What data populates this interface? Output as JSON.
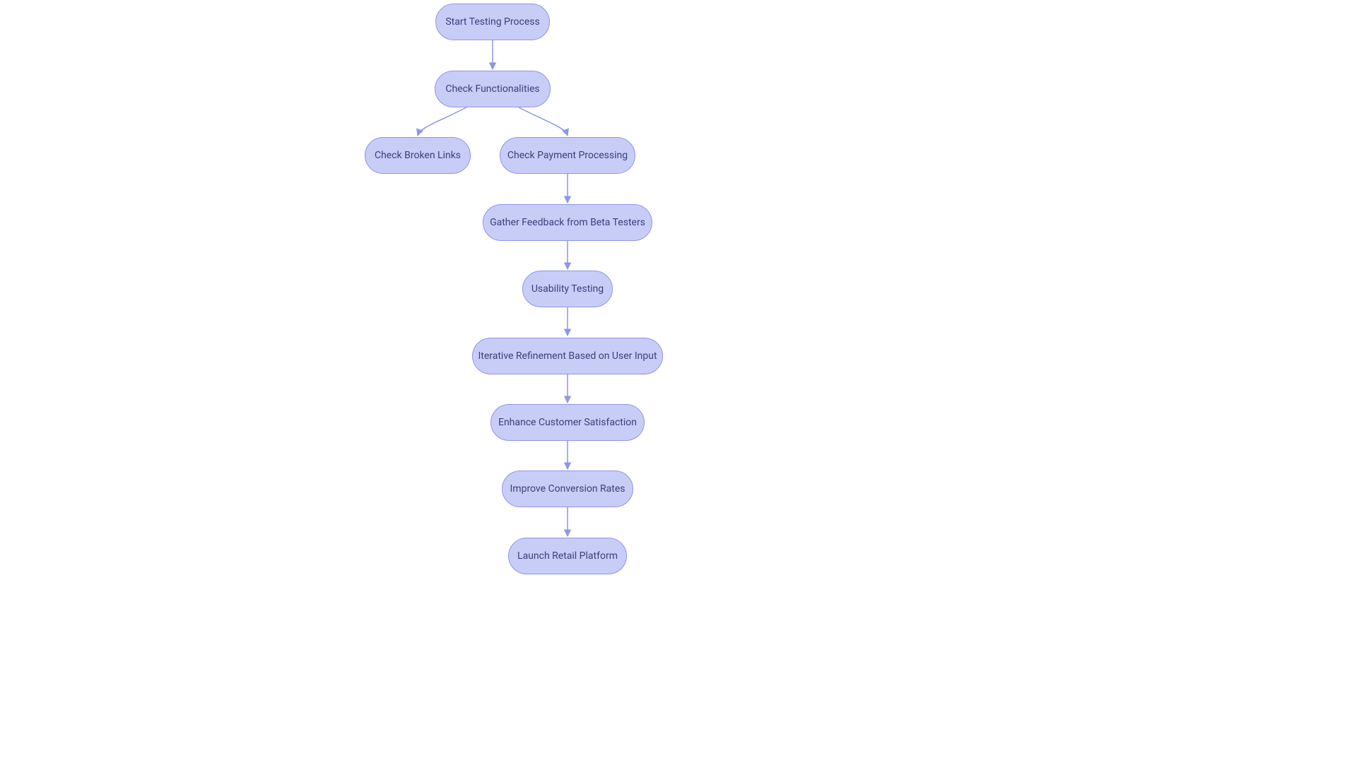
{
  "colors": {
    "node_fill": "#c7cdf7",
    "node_border": "#8e96e6",
    "node_text": "#3a3f7a",
    "edge": "#8e96e6"
  },
  "nodes": {
    "n1": {
      "label": "Start Testing Process"
    },
    "n2": {
      "label": "Check Functionalities"
    },
    "n3": {
      "label": "Check Broken Links"
    },
    "n4": {
      "label": "Check Payment Processing"
    },
    "n5": {
      "label": "Gather Feedback from Beta Testers"
    },
    "n6": {
      "label": "Usability Testing"
    },
    "n7": {
      "label": "Iterative Refinement Based on User Input"
    },
    "n8": {
      "label": "Enhance Customer Satisfaction"
    },
    "n9": {
      "label": "Improve Conversion Rates"
    },
    "n10": {
      "label": "Launch Retail Platform"
    }
  },
  "chart_data": {
    "type": "flowchart",
    "nodes": [
      {
        "id": "n1",
        "label": "Start Testing Process"
      },
      {
        "id": "n2",
        "label": "Check Functionalities"
      },
      {
        "id": "n3",
        "label": "Check Broken Links"
      },
      {
        "id": "n4",
        "label": "Check Payment Processing"
      },
      {
        "id": "n5",
        "label": "Gather Feedback from Beta Testers"
      },
      {
        "id": "n6",
        "label": "Usability Testing"
      },
      {
        "id": "n7",
        "label": "Iterative Refinement Based on User Input"
      },
      {
        "id": "n8",
        "label": "Enhance Customer Satisfaction"
      },
      {
        "id": "n9",
        "label": "Improve Conversion Rates"
      },
      {
        "id": "n10",
        "label": "Launch Retail Platform"
      }
    ],
    "edges": [
      {
        "from": "n1",
        "to": "n2"
      },
      {
        "from": "n2",
        "to": "n3"
      },
      {
        "from": "n2",
        "to": "n4"
      },
      {
        "from": "n4",
        "to": "n5"
      },
      {
        "from": "n5",
        "to": "n6"
      },
      {
        "from": "n6",
        "to": "n7"
      },
      {
        "from": "n7",
        "to": "n8"
      },
      {
        "from": "n8",
        "to": "n9"
      },
      {
        "from": "n9",
        "to": "n10"
      }
    ]
  }
}
